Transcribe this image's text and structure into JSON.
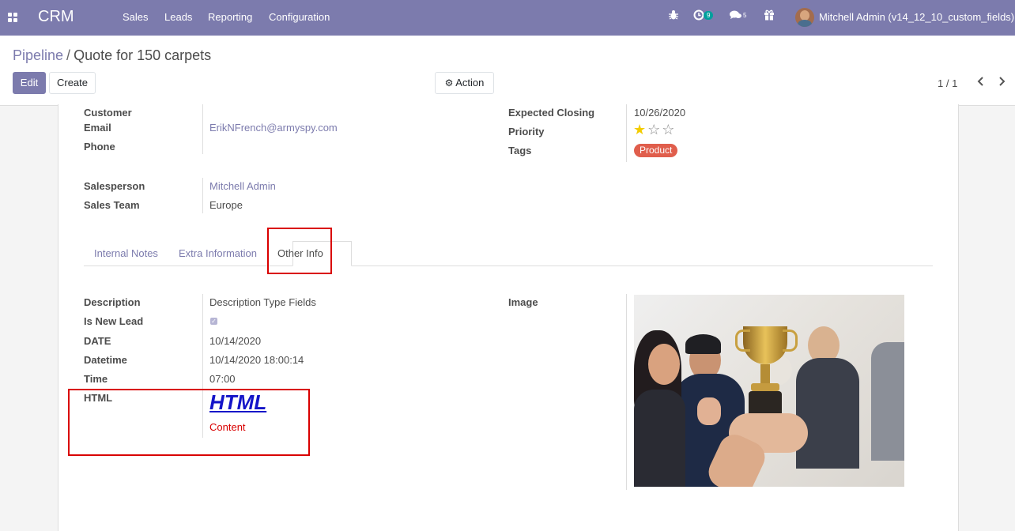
{
  "topbar": {
    "app_name": "CRM",
    "menu": [
      "Sales",
      "Leads",
      "Reporting",
      "Configuration"
    ],
    "activity_count": "9",
    "message_count": "5",
    "user": "Mitchell Admin (v14_12_10_custom_fields)",
    "accent": "#7c7bad"
  },
  "breadcrumb": {
    "parent": "Pipeline",
    "separator": "/",
    "current": "Quote for 150 carpets"
  },
  "buttons": {
    "edit": "Edit",
    "create": "Create",
    "action": "Action"
  },
  "pager": "1 / 1",
  "form": {
    "customer_label": "Customer",
    "email_label": "Email",
    "email_value": "ErikNFrench@armyspy.com",
    "phone_label": "Phone",
    "expected_closing_label": "Expected Closing",
    "expected_closing_value": "10/26/2020",
    "priority_label": "Priority",
    "priority_stars": 1,
    "priority_max": 3,
    "tags_label": "Tags",
    "tag": "Product",
    "tag_color": "#e05e4c",
    "salesperson_label": "Salesperson",
    "salesperson_value": "Mitchell Admin",
    "sales_team_label": "Sales Team",
    "sales_team_value": "Europe"
  },
  "tabs": [
    {
      "label": "Internal Notes",
      "active": false
    },
    {
      "label": "Extra Information",
      "active": false
    },
    {
      "label": "Other Info",
      "active": true
    }
  ],
  "other_info": {
    "description_label": "Description",
    "description_value": "Description Type Fields",
    "is_new_lead_label": "Is New Lead",
    "is_new_lead_checked": true,
    "date_label": "DATE",
    "date_value": "10/14/2020",
    "datetime_label": "Datetime",
    "datetime_value": "10/14/2020 18:00:14",
    "time_label": "Time",
    "time_value": "07:00",
    "html_label": "HTML",
    "html_heading": "HTML",
    "html_content": "Content",
    "image_label": "Image"
  }
}
